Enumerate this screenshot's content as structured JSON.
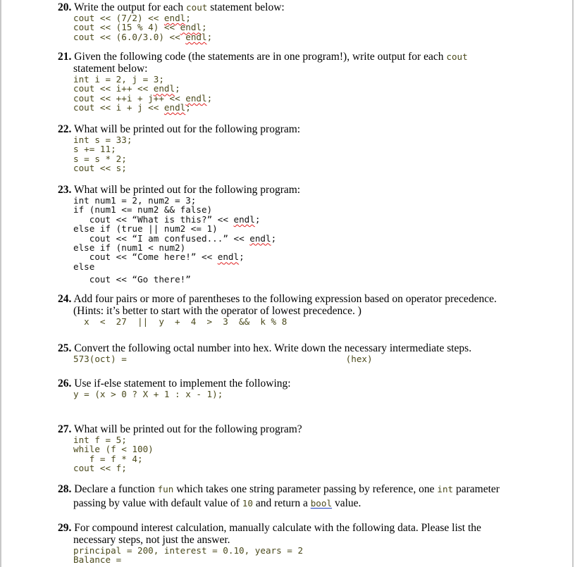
{
  "questions": [
    {
      "number": "20.",
      "text": "Write the output for each ",
      "inline_code": "cout",
      "text_after": " statement below:",
      "code": [
        "cout << (7/2) << endl;",
        "cout << (15 % 4) << endl;",
        "cout << (6.0/3.0) << endl;"
      ]
    },
    {
      "number": "21.",
      "text": "Given the following code (the statements are in one program!), write output for each ",
      "inline_code": "cout",
      "text_after": "statement below:",
      "code": [
        "int i = 2, j = 3;",
        "cout << i++ << endl;",
        "cout << ++i + j++ << endl;",
        "cout << i + j << endl;"
      ]
    },
    {
      "number": "22.",
      "text": "What will be printed out for the following program:",
      "code": [
        "int s = 33;",
        "s += 11;",
        "s = s * 2;",
        "cout << s;"
      ]
    },
    {
      "number": "23.",
      "text": "What will be printed out for the following program:",
      "code": [
        "int num1 = 2, num2 = 3;",
        "if (num1 <= num2 && false)",
        "   cout << “What is this?” << endl;",
        "else if (true || num2 <= 1)",
        "   cout << “I am confused...” << endl;",
        "else if (num1 < num2)",
        "   cout << “Come here!” << endl;",
        "else",
        "   cout << “Go there!”"
      ]
    },
    {
      "number": "24.",
      "text": "Add four pairs or more of  parentheses to the following expression based on operator precedence.",
      "text_line2": "(Hints: it’s better to start with the operator of lowest precedence. )",
      "code": [
        "  x  <  27  ||  y  +  4  >  3  &&  k % 8"
      ]
    },
    {
      "number": "25.",
      "text": "Convert the following octal number into hex. Write down the necessary intermediate steps.",
      "code": [
        "573(oct) =                                         (hex)"
      ]
    },
    {
      "number": "26.",
      "text": "Use if-else statement to implement the following:",
      "code": [
        "y = (x > 0 ? X + 1 : x - 1);"
      ]
    },
    {
      "number": "27.",
      "text": "What will be printed out for the following program?",
      "code": [
        "int f = 5;",
        "while (f < 100)",
        "   f = f * 4;",
        "cout << f;"
      ]
    },
    {
      "number": "28.",
      "text_a": "Declare a function ",
      "code_fun": "fun",
      "text_b": " which takes one string parameter passing by reference, one ",
      "code_int": "int",
      "text_c": " parameter",
      "text_d": "passing by value with default value of ",
      "code_10": "10",
      "text_e": " and return a ",
      "code_bool": "bool",
      "text_f": " value."
    },
    {
      "number": "29.",
      "text": "For compound interest calculation, manually calculate with the following data. Please list the",
      "text_line2": "necessary steps, not just the answer.",
      "code": [
        "principal = 200, interest = 0.10, years = 2",
        "Balance ="
      ]
    }
  ],
  "colors": {
    "code": "#4b4a1c",
    "spellcheck": "#e02020",
    "link_underline": "#1a3fbf"
  }
}
